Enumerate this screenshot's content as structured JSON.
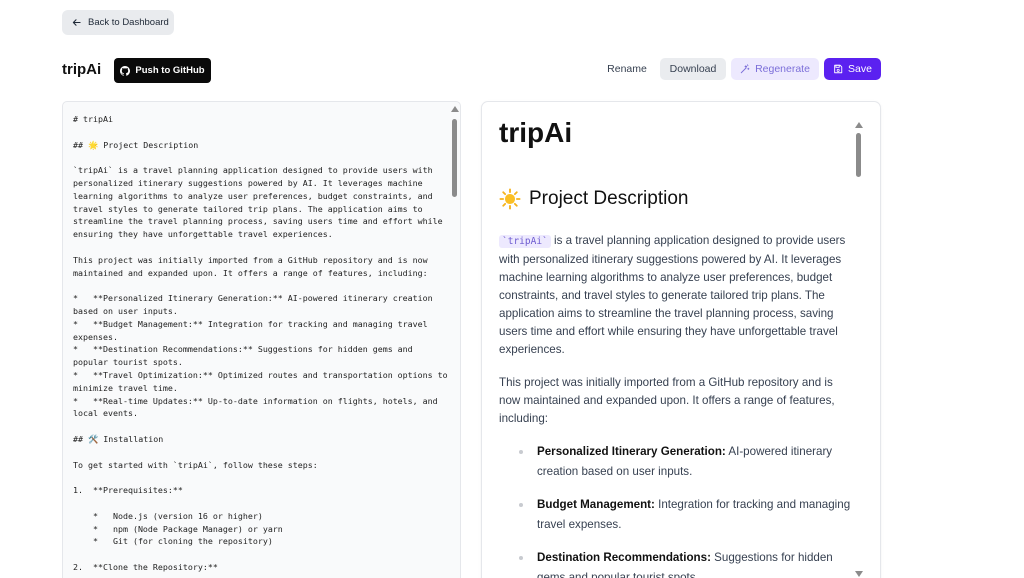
{
  "nav": {
    "back_label": "Back to Dashboard"
  },
  "header": {
    "title": "tripAi",
    "github_label": "Push to GitHub",
    "rename_label": "Rename",
    "download_label": "Download",
    "regenerate_label": "Regenerate",
    "save_label": "Save"
  },
  "colors": {
    "accent": "#5b21f0",
    "regenerate_bg": "#ede9fe",
    "github_bg": "#0a0a0a"
  },
  "editor": {
    "content": "# tripAi\n\n## 🌟 Project Description\n\n`tripAi` is a travel planning application designed to provide users with personalized itinerary suggestions powered by AI. It leverages machine learning algorithms to analyze user preferences, budget constraints, and travel styles to generate tailored trip plans. The application aims to streamline the travel planning process, saving users time and effort while ensuring they have unforgettable travel experiences.\n\nThis project was initially imported from a GitHub repository and is now maintained and expanded upon. It offers a range of features, including:\n\n*   **Personalized Itinerary Generation:** AI-powered itinerary creation based on user inputs.\n*   **Budget Management:** Integration for tracking and managing travel expenses.\n*   **Destination Recommendations:** Suggestions for hidden gems and popular tourist spots.\n*   **Travel Optimization:** Optimized routes and transportation options to minimize travel time.\n*   **Real-time Updates:** Up-to-date information on flights, hotels, and local events.\n\n## 🛠️ Installation\n\nTo get started with `tripAi`, follow these steps:\n\n1.  **Prerequisites:**\n\n    *   Node.js (version 16 or higher)\n    *   npm (Node Package Manager) or yarn\n    *   Git (for cloning the repository)\n\n2.  **Clone the Repository:**"
  },
  "preview": {
    "h1": "tripAi",
    "h2": "Project Description",
    "h2_icon": "sun-emoji",
    "para1_code": "`tripAi`",
    "para1_rest": " is a travel planning application designed to provide users with personalized itinerary suggestions powered by AI. It leverages machine learning algorithms to analyze user preferences, budget constraints, and travel styles to generate tailored trip plans. The application aims to streamline the travel planning process, saving users time and effort while ensuring they have unforgettable travel experiences.",
    "para2": "This project was initially imported from a GitHub repository and is now maintained and expanded upon. It offers a range of features, including:",
    "features": [
      {
        "title": "Personalized Itinerary Generation:",
        "desc": " AI-powered itinerary creation based on user inputs."
      },
      {
        "title": "Budget Management:",
        "desc": " Integration for tracking and managing travel expenses."
      },
      {
        "title": "Destination Recommendations:",
        "desc": " Suggestions for hidden gems and popular tourist spots."
      }
    ]
  }
}
